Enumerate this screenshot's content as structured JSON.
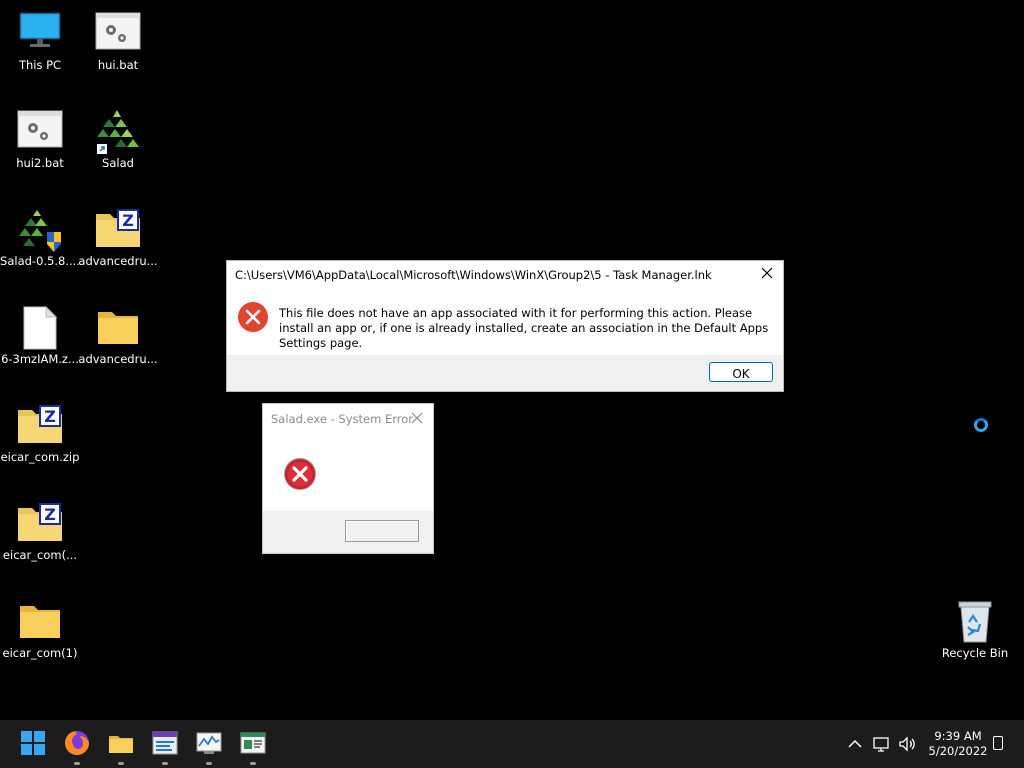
{
  "desktop": {
    "icons": [
      {
        "label": "This PC",
        "icon": "monitor-icon"
      },
      {
        "label": "hui.bat",
        "icon": "batch-file-icon"
      },
      {
        "label": "hui2.bat",
        "icon": "batch-file-icon"
      },
      {
        "label": "Salad",
        "icon": "salad-shortcut-icon"
      },
      {
        "label": "Salad-0.5.8....",
        "icon": "salad-installer-icon"
      },
      {
        "label": "advancedru...",
        "icon": "zip-folder-icon"
      },
      {
        "label": "6-3mzIAM.z...",
        "icon": "file-icon"
      },
      {
        "label": "advancedru...",
        "icon": "folder-icon"
      },
      {
        "label": "eicar_com.zip",
        "icon": "zip-folder-icon"
      },
      {
        "label": "eicar_com(...",
        "icon": "zip-folder-icon"
      },
      {
        "label": "eicar_com(1)",
        "icon": "folder-icon"
      },
      {
        "label": "Recycle Bin",
        "icon": "recycle-bin-icon"
      }
    ]
  },
  "dialog_error": {
    "title": "C:\\Users\\VM6\\AppData\\Local\\Microsoft\\Windows\\WinX\\Group2\\5 - Task Manager.lnk",
    "message": "This file does not have an app associated with it for performing this action. Please install an app or, if one is already installed, create an association in the Default Apps Settings page.",
    "ok_label": "OK",
    "icon": "error-icon"
  },
  "dialog_system": {
    "title": "Salad.exe - System Error",
    "icon": "error-x-icon"
  },
  "taskbar": {
    "apps": [
      "start-icon",
      "firefox-icon",
      "file-explorer-icon",
      "app-window-icon",
      "performance-monitor-icon",
      "task-app-icon"
    ],
    "tray_icons": [
      "chevron-up-icon",
      "network-icon",
      "volume-icon"
    ],
    "time": "9:39 AM",
    "date": "5/20/2022"
  },
  "colors": {
    "accent": "#0067c0",
    "error_red": "#e0452d",
    "taskbar": "#1c1c1c"
  }
}
